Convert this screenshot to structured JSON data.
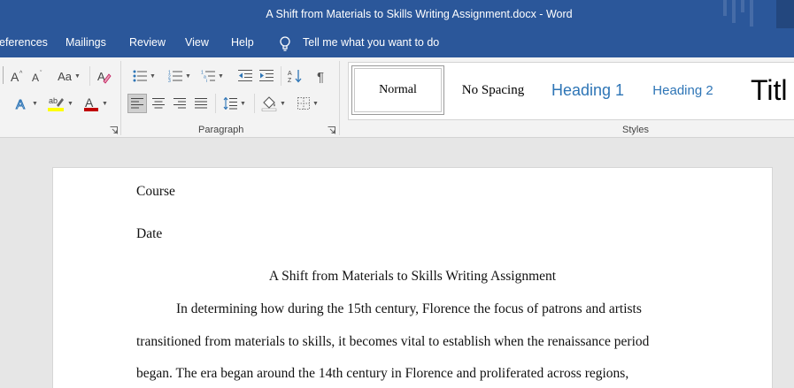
{
  "window": {
    "title": "A Shift from Materials to Skills Writing Assignment.docx  -  Word"
  },
  "menu": {
    "items": [
      "eferences",
      "Mailings",
      "Review",
      "View",
      "Help"
    ],
    "tell_me": "Tell me what you want to do"
  },
  "ribbon": {
    "font_case_label": "Aa",
    "paragraph_label": "Paragraph",
    "styles_label": "Styles",
    "styles": [
      "Normal",
      "No Spacing",
      "Heading 1",
      "Heading 2",
      "Titl"
    ],
    "highlight_color": "#ffff00",
    "font_color": "#c00000"
  },
  "document": {
    "lines": [
      "Course",
      "Date",
      "A Shift from Materials to Skills Writing Assignment",
      "In determining how during the 15th century, Florence the focus of patrons and artists",
      "transitioned from materials to skills, it becomes vital to establish when the renaissance period",
      "began. The era began around the 14th century in Florence and proliferated across regions,"
    ]
  }
}
